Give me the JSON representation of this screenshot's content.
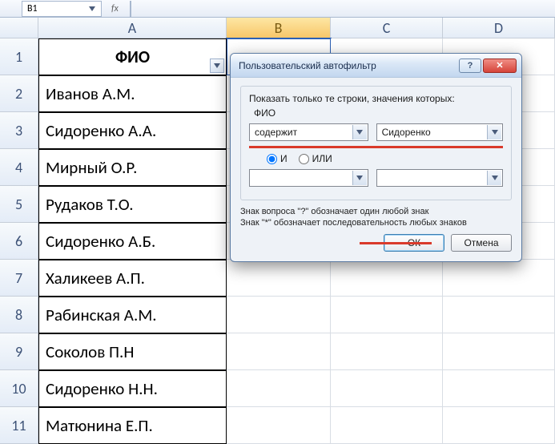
{
  "formula": {
    "namebox": "B1",
    "fx_label": "fx"
  },
  "columns": [
    "A",
    "B",
    "C",
    "D"
  ],
  "active_col_index": 1,
  "header_label": "ФИО",
  "rows": [
    "Иванов А.М.",
    "Сидоренко А.А.",
    "Мирный О.Р.",
    "Рудаков Т.О.",
    "Сидоренко А.Б.",
    "Халикеев А.П.",
    "Рабинская А.М.",
    "Соколов П.Н",
    "Сидоренко Н.Н.",
    "Матюнина Е.П."
  ],
  "dialog": {
    "title": "Пользовательский автофильтр",
    "help": "?",
    "close": "✕",
    "legend": "Показать только те строки, значения которых:",
    "field_name": "ФИО",
    "cond1_op": "содержит",
    "cond1_val": "Сидоренко",
    "cond2_op": "",
    "cond2_val": "",
    "radio_and": "И",
    "radio_or": "ИЛИ",
    "hint1": "Знак вопроса \"?\" обозначает один любой знак",
    "hint2": "Знак \"*\" обозначает последовательность любых знаков",
    "ok": "ОК",
    "cancel": "Отмена"
  }
}
